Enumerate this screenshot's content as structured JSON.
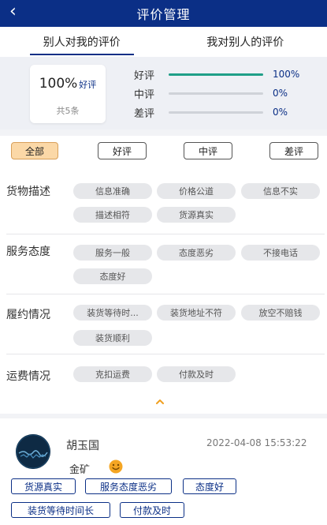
{
  "header": {
    "title": "评价管理",
    "back_icon": "chevron-left-icon"
  },
  "tabs": [
    {
      "label": "别人对我的评价",
      "active": true
    },
    {
      "label": "我对别人的评价",
      "active": false
    }
  ],
  "summary": {
    "percent": "100%",
    "label": "好评",
    "count": "共5条",
    "rates": [
      {
        "name": "好评",
        "value": "100%",
        "fraction": 1.0
      },
      {
        "name": "中评",
        "value": "0%",
        "fraction": 0.0
      },
      {
        "name": "差评",
        "value": "0%",
        "fraction": 0.0
      }
    ]
  },
  "filters": [
    {
      "label": "全部",
      "active": true
    },
    {
      "label": "好评",
      "active": false
    },
    {
      "label": "中评",
      "active": false
    },
    {
      "label": "差评",
      "active": false
    }
  ],
  "sections": [
    {
      "title": "货物描述",
      "tags": [
        "信息准确",
        "价格公道",
        "信息不实",
        "描述相符",
        "货源真实"
      ]
    },
    {
      "title": "服务态度",
      "tags": [
        "服务一般",
        "态度恶劣",
        "不接电话",
        "态度好"
      ]
    },
    {
      "title": "履约情况",
      "tags": [
        "装货等待时...",
        "装货地址不符",
        "放空不赔钱",
        "装货顺利"
      ]
    },
    {
      "title": "运费情况",
      "tags": [
        "克扣运费",
        "付款及时"
      ]
    }
  ],
  "collapse_icon": "chevron-up-icon",
  "comment": {
    "name": "胡玉国",
    "time": "2022-04-08 15:53:22",
    "goods": "金矿",
    "emoji": "smile-icon",
    "tags": [
      "货源真实",
      "服务态度恶劣",
      "态度好",
      "装货等待时间长",
      "付款及时"
    ]
  },
  "colors": {
    "brand": "#0b2f86",
    "good_bar": "#1f9f88",
    "active_filter": "#fbd8a7"
  }
}
